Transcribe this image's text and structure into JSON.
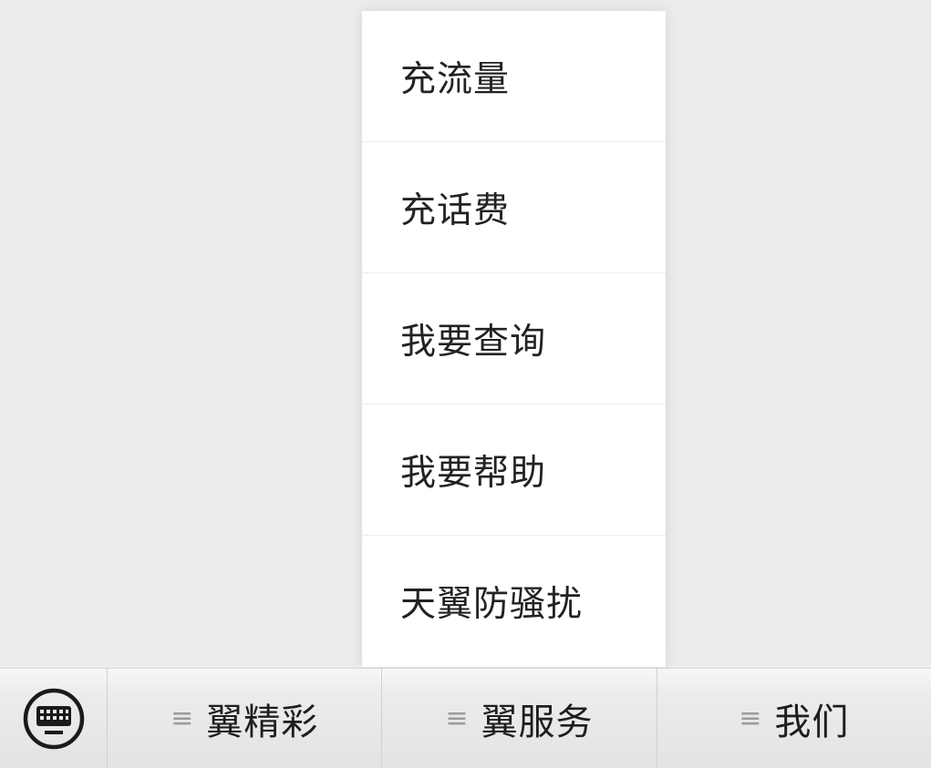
{
  "popup_menu": {
    "items": [
      {
        "label": "充流量"
      },
      {
        "label": "充话费"
      },
      {
        "label": "我要查询"
      },
      {
        "label": "我要帮助"
      },
      {
        "label": "天翼防骚扰"
      }
    ]
  },
  "bottom_bar": {
    "keyboard_icon": "keyboard-icon",
    "menu_icon": "menu-icon",
    "tabs": [
      {
        "label": "翼精彩",
        "icon_glyph": "≡"
      },
      {
        "label": "翼服务",
        "icon_glyph": "≡"
      },
      {
        "label": "我们",
        "icon_glyph": "≡"
      }
    ]
  },
  "colors": {
    "background": "#ececec",
    "menu_background": "#ffffff",
    "text": "#222222",
    "icon_gray": "#9a9a9a"
  }
}
